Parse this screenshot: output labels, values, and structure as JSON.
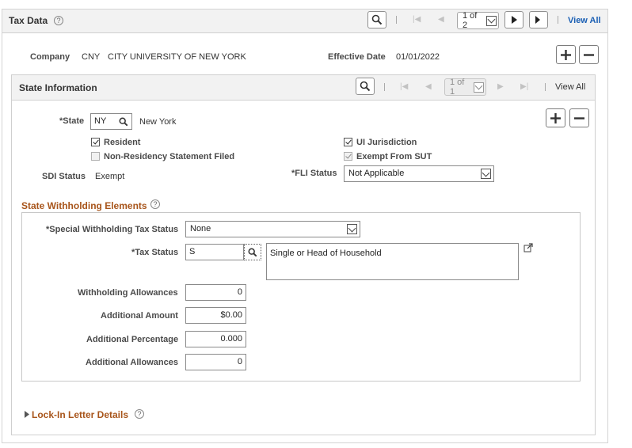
{
  "header": {
    "title": "Tax Data",
    "pager": "1 of 2",
    "view_all": "View All"
  },
  "company": {
    "label": "Company",
    "code": "CNY",
    "name": "CITY UNIVERSITY OF NEW YORK",
    "effective_date_label": "Effective Date",
    "effective_date": "01/01/2022"
  },
  "state_info": {
    "title": "State Information",
    "pager": "1 of 1",
    "view_all": "View All",
    "state_label": "*State",
    "state_value": "NY",
    "state_name": "New York",
    "resident_label": "Resident",
    "resident_checked": true,
    "ui_jurisdiction_label": "UI Jurisdiction",
    "ui_jurisdiction_checked": true,
    "non_residency_label": "Non-Residency Statement Filed",
    "non_residency_checked": false,
    "exempt_sut_label": "Exempt From SUT",
    "exempt_sut_checked": true,
    "sdi_status_label": "SDI Status",
    "sdi_status_value": "Exempt",
    "fli_status_label": "*FLI Status",
    "fli_status_value": "Not Applicable"
  },
  "withholding": {
    "title": "State Withholding Elements",
    "special_status_label": "*Special Withholding Tax Status",
    "special_status_value": "None",
    "tax_status_label": "*Tax Status",
    "tax_status_value": "S",
    "tax_status_desc": "Single or Head of Household",
    "allowances_label": "Withholding Allowances",
    "allowances_value": "0",
    "add_amount_label": "Additional Amount",
    "add_amount_value": "$0.00",
    "add_pct_label": "Additional Percentage",
    "add_pct_value": "0.000",
    "add_allow_label": "Additional Allowances",
    "add_allow_value": "0"
  },
  "lockin": {
    "title": "Lock-In Letter Details"
  }
}
